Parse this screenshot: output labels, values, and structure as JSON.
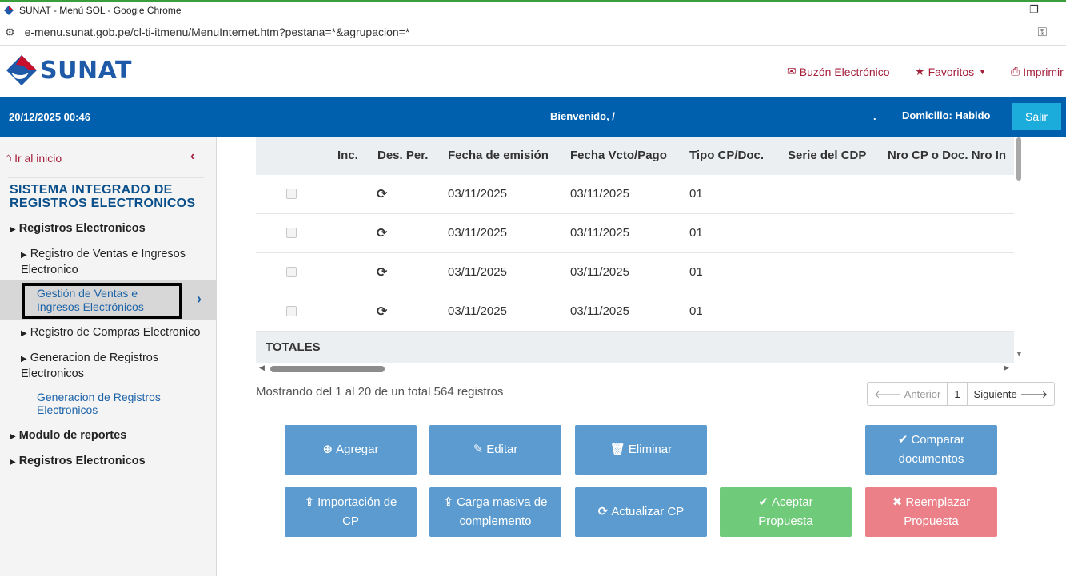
{
  "browser": {
    "title": "SUNAT - Menú SOL - Google Chrome",
    "url": "e-menu.sunat.gob.pe/cl-ti-itmenu/MenuInternet.htm?pestana=*&agrupacion=*"
  },
  "header": {
    "logo_text": "SUNAT",
    "links": [
      "Buzón Electrónico",
      "Favoritos",
      "Imprimir"
    ]
  },
  "userbar": {
    "datetime": "20/12/2025 00:46",
    "welcome": "Bienvenido, /",
    "dot": ".",
    "domicilio": "Domicilio: Habido",
    "logout": "Salir"
  },
  "sidebar": {
    "home": "Ir al inicio",
    "system_title": "SISTEMA INTEGRADO DE REGISTROS ELECTRONICOS",
    "item1": "Registros Electronicos",
    "item2": "Registro de Ventas e Ingresos Electronico",
    "active": "Gestión de Ventas e Ingresos Electrónicos",
    "item3": "Registro de Compras Electronico",
    "item4": "Generacion de Registros Electronicos",
    "item4_sub": "Generacion de Registros Electronicos",
    "item5": "Modulo de reportes",
    "item6": "Registros Electronicos"
  },
  "table": {
    "columns": [
      "Inc.",
      "Des. Per.",
      "Fecha de emisión",
      "Fecha Vcto/Pago",
      "Tipo CP/Doc.",
      "Serie del CDP",
      "Nro CP o Doc. Nro In"
    ],
    "rows": [
      {
        "emision": "03/11/2025",
        "vcto": "03/11/2025",
        "tipo": "01"
      },
      {
        "emision": "03/11/2025",
        "vcto": "03/11/2025",
        "tipo": "01"
      },
      {
        "emision": "03/11/2025",
        "vcto": "03/11/2025",
        "tipo": "01"
      },
      {
        "emision": "03/11/2025",
        "vcto": "03/11/2025",
        "tipo": "01"
      }
    ],
    "totals_label": "TOTALES"
  },
  "pagination": {
    "summary": "Mostrando del 1 al 20 de un total 564 registros",
    "prev": "Anterior",
    "page": "1",
    "next": "Siguiente"
  },
  "buttons": {
    "agregar": "Agregar",
    "editar": "Editar",
    "eliminar": "Eliminar",
    "comparar": "Comparar documentos",
    "importacion": "Importación de CP",
    "carga": "Carga masiva de complemento",
    "actualizar": "Actualizar CP",
    "aceptar": "Aceptar Propuesta",
    "reemplazar": "Reemplazar Propuesta"
  },
  "colors": {
    "brand_blue": "#0060ad",
    "brand_red": "#a5203b",
    "btn_blue": "#5b9bd0",
    "btn_green": "#6fcb7a",
    "btn_red": "#ec8088",
    "salir": "#1bacdc"
  }
}
